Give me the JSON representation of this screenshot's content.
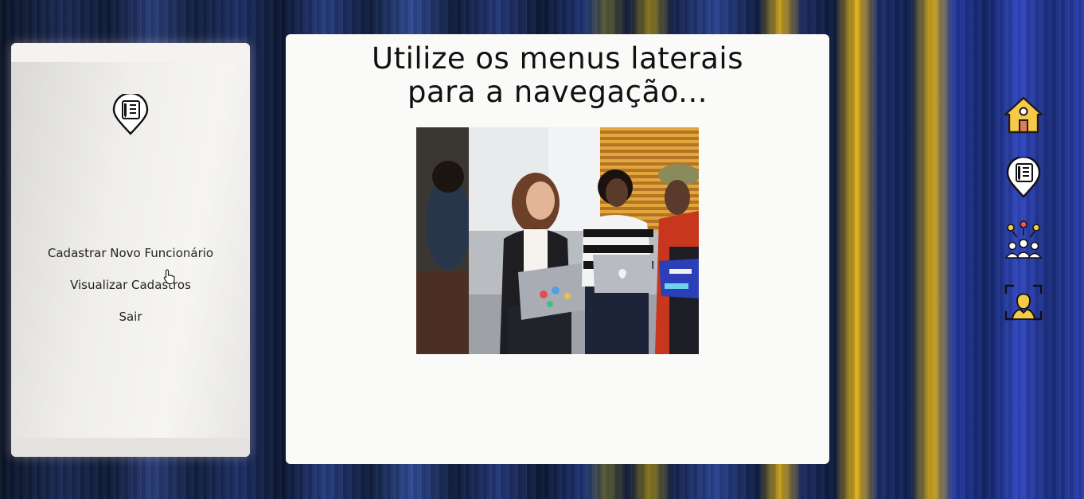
{
  "main": {
    "title_line1": "Utilize os menus laterais",
    "title_line2": "para a navegação..."
  },
  "sidebar": {
    "items": [
      {
        "label": "Cadastrar Novo Funcionário"
      },
      {
        "label": "Visualizar Cadastros"
      },
      {
        "label": "Sair"
      }
    ]
  },
  "right_nav": {
    "icons": [
      "home-icon",
      "document-pin-icon",
      "team-ideas-icon",
      "face-scan-icon"
    ]
  },
  "colors": {
    "accent_yellow": "#f7c948",
    "card_background": "#fafaf8"
  }
}
